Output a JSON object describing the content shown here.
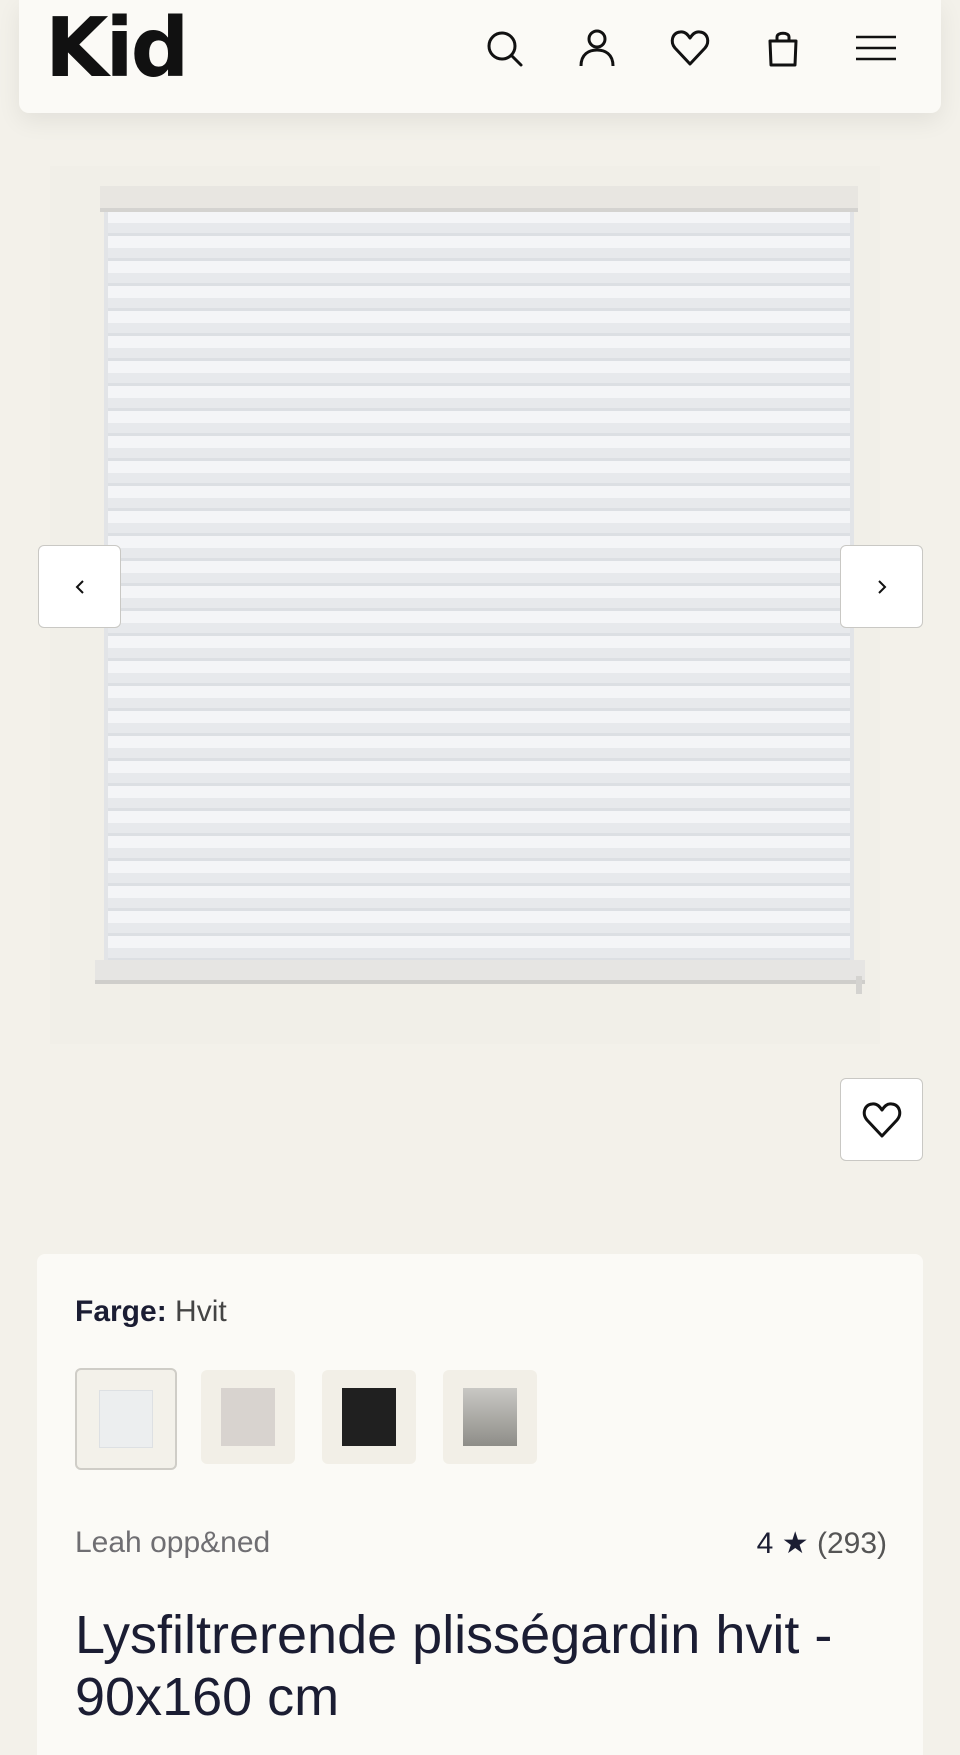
{
  "header": {
    "logo": "Kid",
    "icons": [
      "search-icon",
      "account-icon",
      "heart-icon",
      "bag-icon",
      "menu-icon"
    ]
  },
  "gallery": {
    "image_alt": "Lysfiltrerende plisségardin hvit",
    "prev_icon": "chevron-left-icon",
    "next_icon": "chevron-right-icon",
    "favorite_icon": "heart-icon"
  },
  "product": {
    "color_label": "Farge:",
    "color_value": "Hvit",
    "swatches": [
      {
        "name": "Hvit",
        "color": "#eceeef",
        "selected": true
      },
      {
        "name": "Beige",
        "color": "#d8d3cf",
        "selected": false
      },
      {
        "name": "Sort",
        "color": "#202020",
        "selected": false
      },
      {
        "name": "Grå",
        "color": "#9a9994",
        "selected": false
      }
    ],
    "brand": "Leah opp&ned",
    "rating_value": "4",
    "rating_star": "★",
    "rating_count": "(293)",
    "title": "Lysfiltrerende plisségardin hvit - 90x160 cm"
  }
}
